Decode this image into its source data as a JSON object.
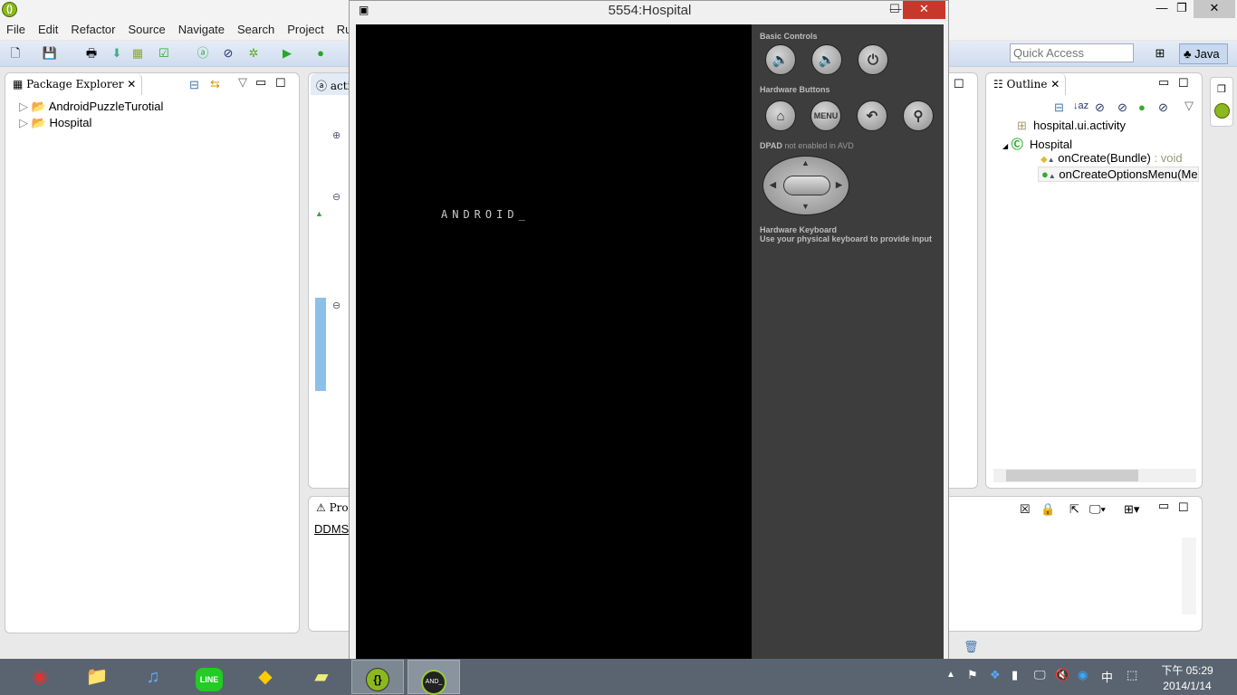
{
  "eclipse": {
    "menu": [
      "File",
      "Edit",
      "Refactor",
      "Source",
      "Navigate",
      "Search",
      "Project",
      "Run"
    ],
    "quick_access_placeholder": "Quick Access",
    "perspective": "Java",
    "package_explorer": {
      "title": "Package Explorer",
      "projects": [
        "AndroidPuzzleTurotial",
        "Hospital"
      ]
    },
    "editor": {
      "tab": "activ"
    },
    "outline": {
      "title": "Outline",
      "items": [
        {
          "label": "hospital.ui.activity",
          "suffix": ""
        },
        {
          "label": "Hospital",
          "suffix": ""
        },
        {
          "label": "onCreate(Bundle)",
          "suffix": " : void"
        },
        {
          "label": "onCreateOptionsMenu(Me",
          "suffix": ""
        }
      ]
    },
    "bottom": {
      "tab": "Prob",
      "console_label": "DDMS"
    }
  },
  "emulator": {
    "title": "5554:Hospital",
    "screen_text": "ANDROID_",
    "basic_controls": "Basic Controls",
    "hardware_buttons": "Hardware Buttons",
    "menu_button": "MENU",
    "dpad_bold": "DPAD",
    "dpad_note": " not enabled in AVD",
    "keyboard_title": "Hardware Keyboard",
    "keyboard_note": "Use your physical keyboard to provide input"
  },
  "taskbar": {
    "time": "下午 05:29",
    "date": "2014/1/14",
    "ime": "中",
    "apps": [
      "chrome",
      "file-explorer",
      "itunes",
      "line",
      "app-yellow",
      "sticky-notes",
      "eclipse",
      "android-emulator"
    ]
  }
}
